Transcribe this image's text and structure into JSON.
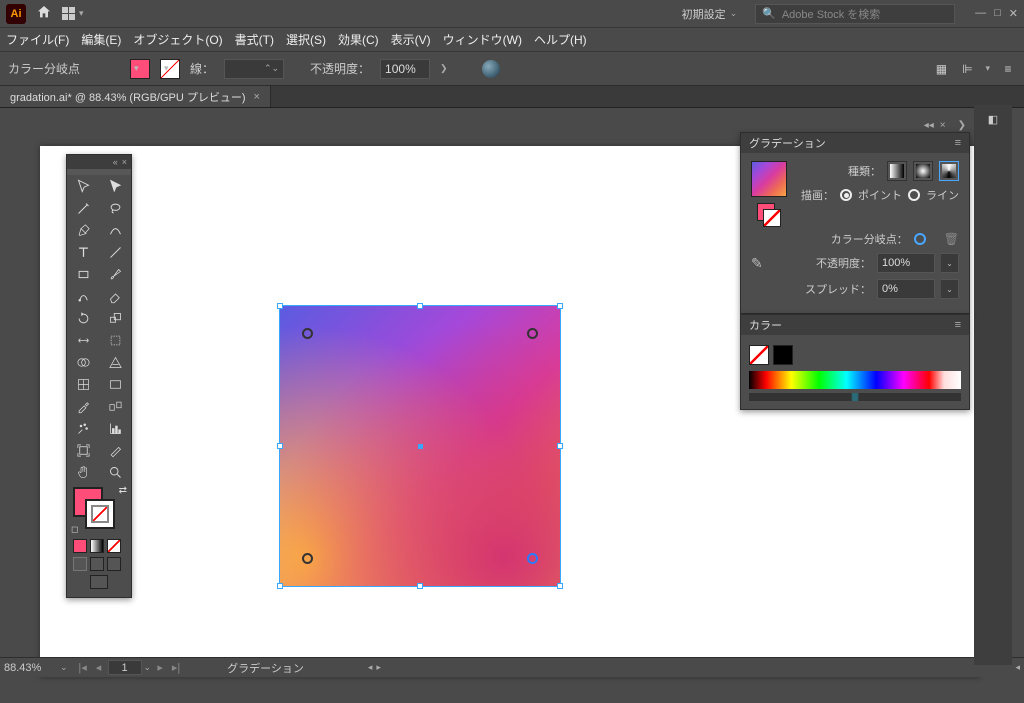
{
  "titlebar": {
    "logo": "Ai",
    "preset_label": "初期設定",
    "search_placeholder": "Adobe Stock を検索"
  },
  "menu": {
    "file": "ファイル(F)",
    "edit": "編集(E)",
    "object": "オブジェクト(O)",
    "type": "書式(T)",
    "select": "選択(S)",
    "effect": "効果(C)",
    "view": "表示(V)",
    "window": "ウィンドウ(W)",
    "help": "ヘルプ(H)"
  },
  "control": {
    "label": "カラー分岐点",
    "stroke_label": "線：",
    "stroke_pt": "",
    "opacity_label": "不透明度：",
    "opacity_value": "100%"
  },
  "doc": {
    "tab_title": "gradation.ai* @ 88.43% (RGB/GPU プレビュー)"
  },
  "panels": {
    "gradient": {
      "title": "グラデーション",
      "type_label": "種類：",
      "draw_label": "描画：",
      "draw_point": "ポイント",
      "draw_line": "ライン",
      "colorstop_label": "カラー分岐点：",
      "opacity_label": "不透明度：",
      "opacity_value": "100%",
      "spread_label": "スプレッド：",
      "spread_value": "0%"
    },
    "color": {
      "title": "カラー"
    }
  },
  "status": {
    "zoom": "88.43%",
    "page": "1",
    "layer": "グラデーション"
  },
  "colors": {
    "fill": "#ff4d7a",
    "black": "#000000",
    "mid": "#555555"
  }
}
